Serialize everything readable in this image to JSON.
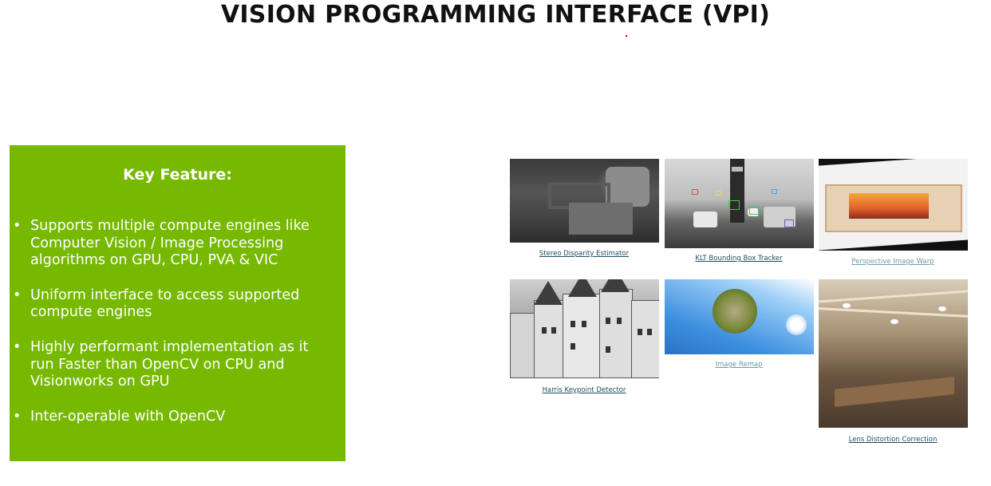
{
  "slide": {
    "title": "VISION PROGRAMMING INTERFACE (VPI)"
  },
  "feature_box": {
    "heading": "Key Feature:",
    "bullet_symbol": "•",
    "bullets": [
      "Supports multiple compute engines like Computer Vision / Image Processing algorithms on GPU, CPU, PVA & VIC",
      "Uniform interface to access supported compute engines",
      "Highly performant implementation as it run Faster than OpenCV on CPU and Visionworks on GPU",
      "Inter-operable with OpenCV"
    ],
    "background_color": "#76b900"
  },
  "gallery": {
    "items": [
      {
        "caption": "Stereo Disparity Estimator"
      },
      {
        "caption": "KLT Bounding Box Tracker"
      },
      {
        "caption": "Perspective Image Warp"
      },
      {
        "caption": "Harris Keypoint Detector"
      },
      {
        "caption": "Image Remap"
      },
      {
        "caption": "Lens Distortion Correction"
      }
    ]
  }
}
